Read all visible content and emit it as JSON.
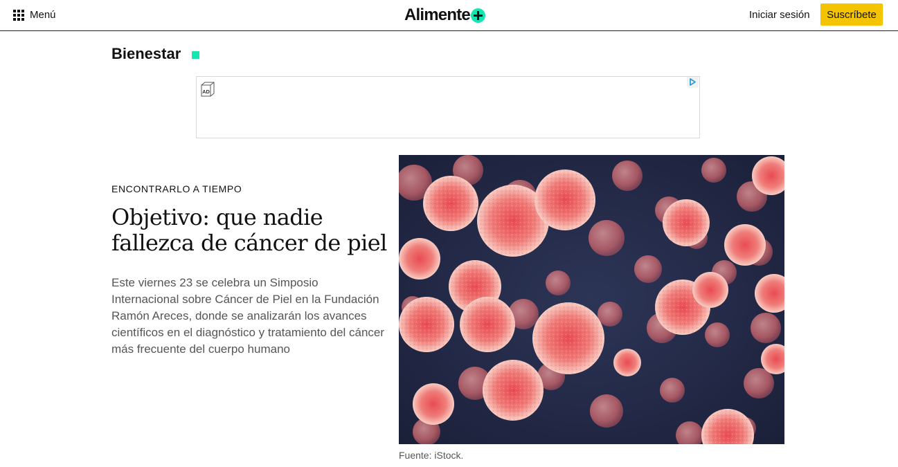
{
  "header": {
    "menu_label": "Menú",
    "logo_text": "Alimente",
    "login_label": "Iniciar sesión",
    "subscribe_label": "Suscríbete"
  },
  "section": {
    "title": "Bienestar"
  },
  "ad": {
    "badge_text": "AD"
  },
  "article": {
    "kicker": "ENCONTRARLO A TIEMPO",
    "headline": "Objetivo: que nadie fallezca de cáncer de piel",
    "summary": "Este viernes 23 se celebra un Simposio Internacional sobre Cáncer de Piel en la Fundación Ramón Areces, donde se analizarán los avances científicos en el diagnóstico y tratamiento del cáncer más frecuente del cuerpo humano",
    "caption": "Fuente: iStock."
  },
  "colors": {
    "accent": "#14e5b3",
    "subscribe_bg": "#f5c400",
    "image_background": "#202845",
    "cell_color": "#e8716f"
  },
  "icons": {
    "menu": "grid-icon",
    "logo_mark": "plus-circle-icon",
    "ad_badge": "ad-badge-icon",
    "ad_choices": "ad-choices-icon"
  }
}
